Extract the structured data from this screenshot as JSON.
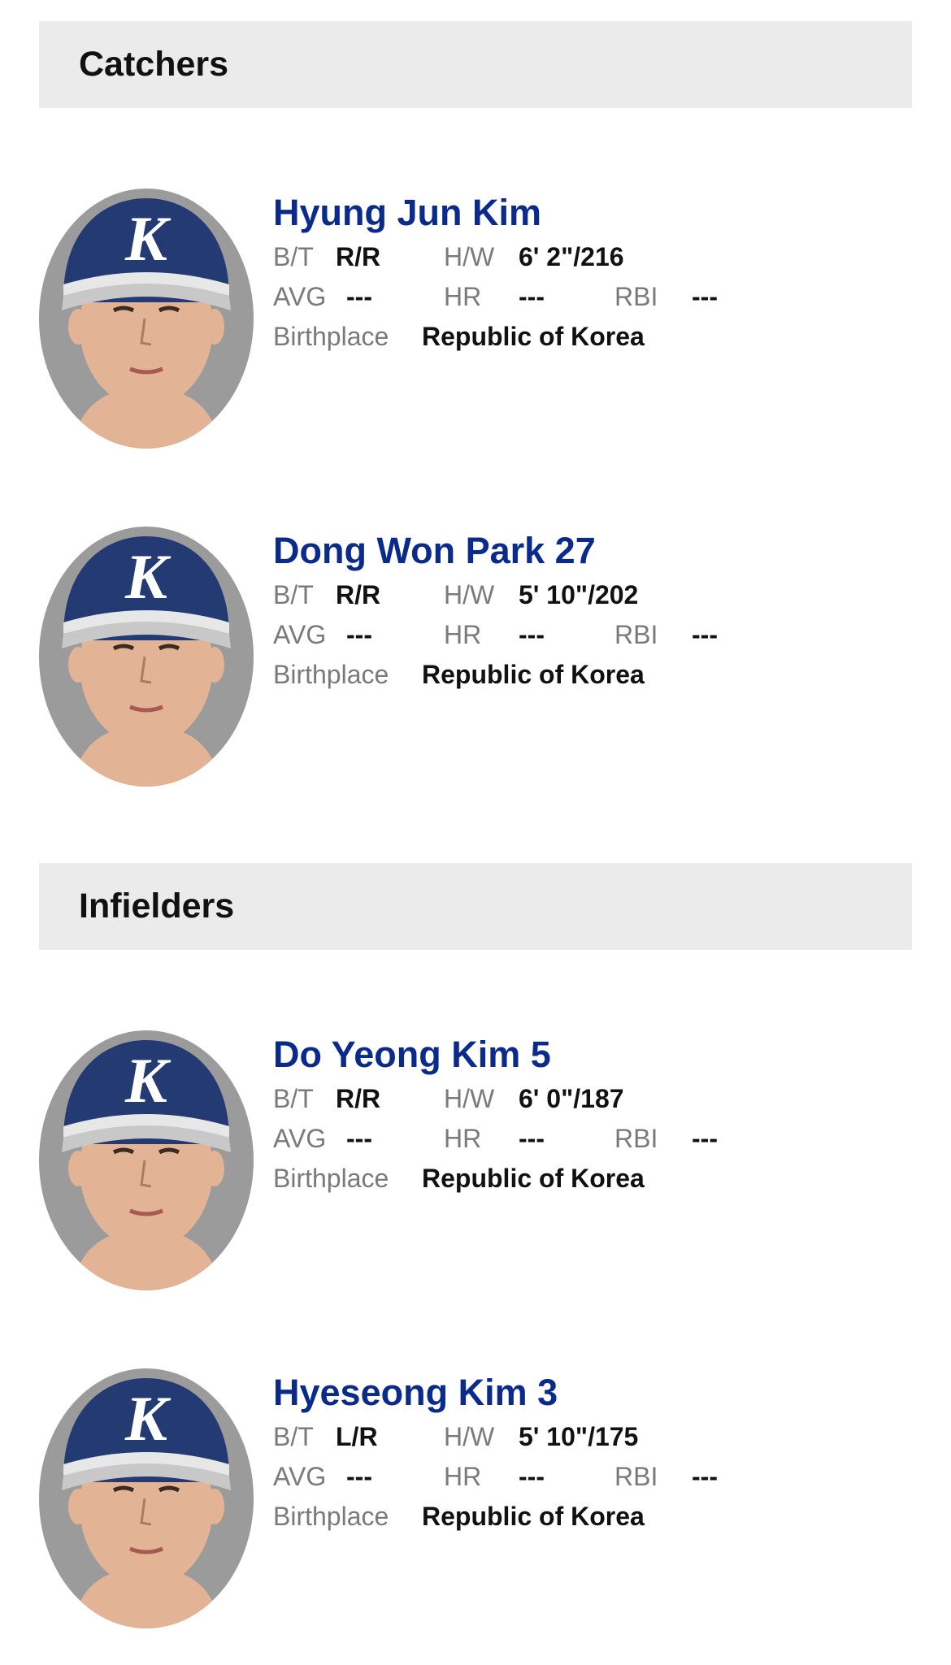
{
  "sections": [
    {
      "title": "Catchers",
      "players": [
        {
          "name": "Hyung Jun Kim",
          "bt_label": "B/T",
          "bt": "R/R",
          "hw_label": "H/W",
          "hw": "6' 2\"/216",
          "avg_label": "AVG",
          "avg": "---",
          "hr_label": "HR",
          "hr": "---",
          "rbi_label": "RBI",
          "rbi": "---",
          "birthplace_label": "Birthplace",
          "birthplace": "Republic of Korea"
        },
        {
          "name": "Dong Won Park 27",
          "bt_label": "B/T",
          "bt": "R/R",
          "hw_label": "H/W",
          "hw": "5' 10\"/202",
          "avg_label": "AVG",
          "avg": "---",
          "hr_label": "HR",
          "hr": "---",
          "rbi_label": "RBI",
          "rbi": "---",
          "birthplace_label": "Birthplace",
          "birthplace": "Republic of Korea"
        }
      ]
    },
    {
      "title": "Infielders",
      "players": [
        {
          "name": "Do Yeong Kim 5",
          "bt_label": "B/T",
          "bt": "R/R",
          "hw_label": "H/W",
          "hw": "6' 0\"/187",
          "avg_label": "AVG",
          "avg": "---",
          "hr_label": "HR",
          "hr": "---",
          "rbi_label": "RBI",
          "rbi": "---",
          "birthplace_label": "Birthplace",
          "birthplace": "Republic of Korea"
        },
        {
          "name": "Hyeseong Kim 3",
          "bt_label": "B/T",
          "bt": "L/R",
          "hw_label": "H/W",
          "hw": "5' 10\"/175",
          "avg_label": "AVG",
          "avg": "---",
          "hr_label": "HR",
          "hr": "---",
          "rbi_label": "RBI",
          "rbi": "---",
          "birthplace_label": "Birthplace",
          "birthplace": "Republic of Korea"
        }
      ]
    }
  ],
  "headshot": {
    "background_color": "#9b9b9b",
    "cap_color": "#243a73",
    "cap_logo": "K",
    "skin_color": "#e2b394"
  },
  "colors": {
    "player_name": "#0a2a8c",
    "label": "#7a7a7a",
    "value": "#111111",
    "section_bg": "#ebebeb"
  }
}
